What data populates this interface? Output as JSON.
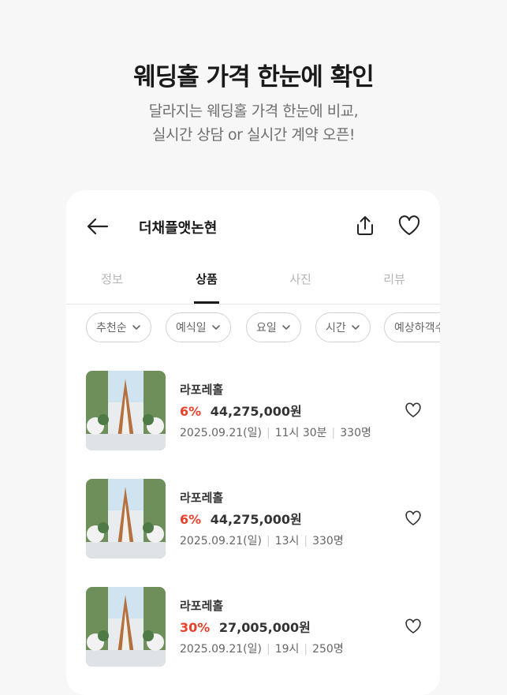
{
  "promo": {
    "title": "웨딩홀 가격 한눈에 확인",
    "subtitle_line1": "달라지는 웨딩홀 가격 한눈에 비교,",
    "subtitle_line2": "실시간 상담 or 실시간 계약 오픈!"
  },
  "header": {
    "venue_name": "더채플앳논현",
    "icons": [
      "back-arrow-icon",
      "share-icon",
      "heart-icon"
    ]
  },
  "tabs": [
    {
      "label": "정보",
      "active": false
    },
    {
      "label": "상품",
      "active": true
    },
    {
      "label": "사진",
      "active": false
    },
    {
      "label": "리뷰",
      "active": false
    }
  ],
  "filters": [
    {
      "label": "추천순"
    },
    {
      "label": "예식일"
    },
    {
      "label": "요일"
    },
    {
      "label": "시간"
    },
    {
      "label": "예상하객수"
    }
  ],
  "products": [
    {
      "hall": "라포레홀",
      "discount": "6%",
      "price": "44,275,000원",
      "date": "2025.09.21(일)",
      "time": "11시 30분",
      "guests": "330명"
    },
    {
      "hall": "라포레홀",
      "discount": "6%",
      "price": "44,275,000원",
      "date": "2025.09.21(일)",
      "time": "13시",
      "guests": "330명"
    },
    {
      "hall": "라포레홀",
      "discount": "30%",
      "price": "27,005,000원",
      "date": "2025.09.21(일)",
      "time": "19시",
      "guests": "250명"
    }
  ],
  "colors": {
    "accent": "#e8412c",
    "background": "#f7f7f7",
    "card": "#ffffff"
  }
}
